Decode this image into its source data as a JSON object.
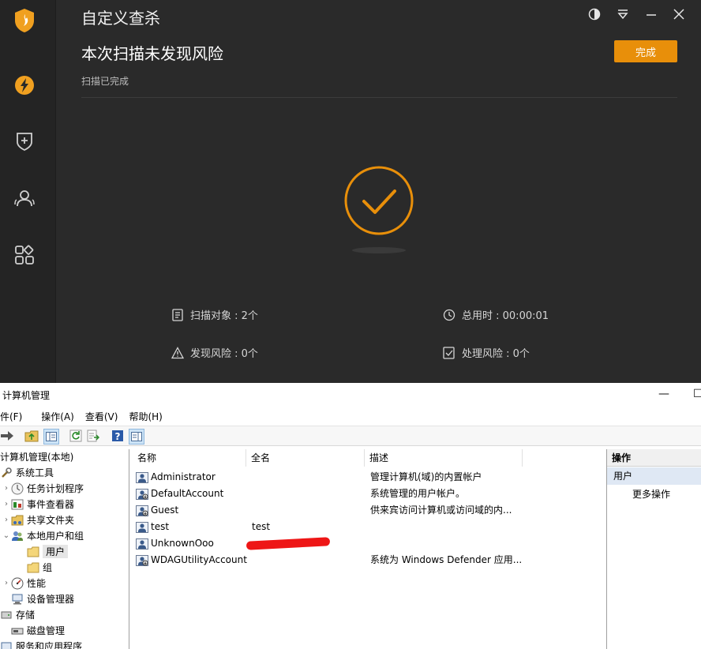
{
  "security_app": {
    "title": "自定义查杀",
    "headline": "本次扫描未发现风险",
    "status": "扫描已完成",
    "done_button": "完成",
    "accent": "#e88f0a",
    "sidebar_icons": [
      "shield-logo-icon",
      "lightning-icon",
      "shield-plus-icon",
      "users-icon",
      "apps-icon"
    ],
    "window_controls": [
      "theme-icon",
      "dropdown-icon",
      "minimize-icon",
      "close-icon"
    ],
    "stats": {
      "scan_targets": "扫描对象 : 2个",
      "total_time": "总用时 : 00:00:01",
      "risks_found": "发现风险 : 0个",
      "risks_handled": "处理风险 : 0个"
    }
  },
  "computer_management": {
    "title": "计算机管理",
    "menu": [
      "件(F)",
      "操作(A)",
      "查看(V)",
      "帮助(H)"
    ],
    "tree": [
      {
        "label": "计算机管理(本地)"
      },
      {
        "label": "系统工具"
      },
      {
        "label": "任务计划程序"
      },
      {
        "label": "事件查看器"
      },
      {
        "label": "共享文件夹"
      },
      {
        "label": "本地用户和组"
      },
      {
        "label": "用户"
      },
      {
        "label": "组"
      },
      {
        "label": "性能"
      },
      {
        "label": "设备管理器"
      },
      {
        "label": "存储"
      },
      {
        "label": "磁盘管理"
      },
      {
        "label": "服务和应用程序"
      }
    ],
    "columns": [
      "名称",
      "全名",
      "描述"
    ],
    "rows": [
      {
        "name": "Administrator",
        "full_name": "",
        "description": "管理计算机(域)的内置帐户"
      },
      {
        "name": "DefaultAccount",
        "full_name": "",
        "description": "系统管理的用户帐户。"
      },
      {
        "name": "Guest",
        "full_name": "",
        "description": "供来宾访问计算机或访问域的内..."
      },
      {
        "name": "test",
        "full_name": "test",
        "description": ""
      },
      {
        "name": "UnknownOoo",
        "full_name": "",
        "description": ""
      },
      {
        "name": "WDAGUtilityAccount",
        "full_name": "",
        "description": "系统为 Windows Defender 应用..."
      }
    ],
    "actions": {
      "header": "操作",
      "selected": "用户",
      "more": "更多操作"
    }
  }
}
